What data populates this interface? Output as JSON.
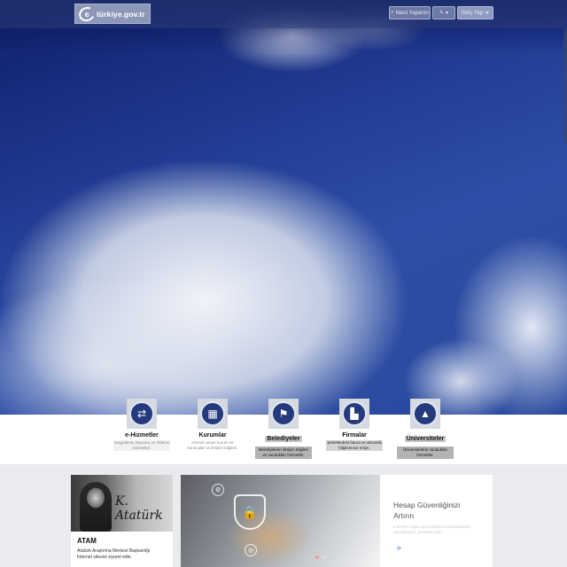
{
  "header": {
    "logo_text": "türkiye.gov.tr",
    "logo_letter": "e",
    "search_label": "Nasıl Yaparım",
    "tools_icon": "wrench-icon",
    "login_label": "Giriş Yap"
  },
  "services": [
    {
      "title": "e-Hizmetler",
      "desc": "Sorgulama, Başvuru ve Ödeme Hizmetleri.",
      "icon": "refresh-arrows-icon",
      "glyph": "⇄"
    },
    {
      "title": "Kurumlar",
      "desc": "Hizmet sunan kurum ve kuruluşlar ve iletişim bilgileri.",
      "icon": "building-icon",
      "glyph": "▦"
    },
    {
      "title": "Belediyeler",
      "desc": "Belediyelerin iletişim bilgileri ve sundukları hizmetler.",
      "icon": "signpost-icon",
      "glyph": "⚑"
    },
    {
      "title": "Firmalar",
      "desc": "Şirketlerdeki fatura ve abonelik bilgilerinize erişin.",
      "icon": "factory-icon",
      "glyph": "▙"
    },
    {
      "title": "Üniversiteler",
      "desc": "Üniversitelerin sundukları hizmetler.",
      "icon": "graduation-cap-icon",
      "glyph": "🎓"
    }
  ],
  "atam": {
    "title": "ATAM",
    "desc": "Atatürk Araştırma Merkezi Başkanlığı İnternet sitesini ziyaret edin.",
    "signature": "K. Atatürk"
  },
  "security": {
    "title": "Hesap Güvenliğinizi Artırın",
    "desc": "e-Devlet Kapısı giriş bilgileriniz başkalarıyla paylaşmayın, güvende kalın."
  }
}
